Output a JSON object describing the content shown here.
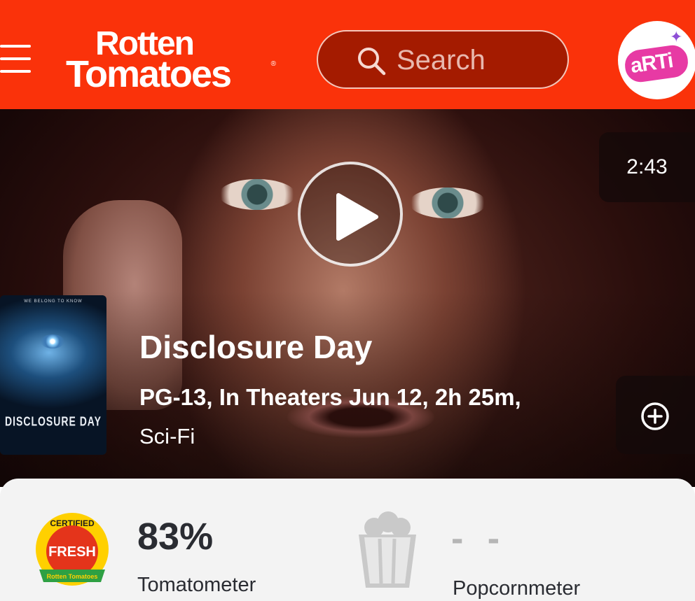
{
  "header": {
    "logo_line1": "Rotten",
    "logo_line2": "Tomatoes",
    "logo_reg": "®",
    "search_placeholder": "Search",
    "avatar_text": "aRTi",
    "brand_color": "#fa320a"
  },
  "hero": {
    "trailer_duration": "2:43",
    "poster": {
      "tagline": "WE BELONG TO KNOW",
      "title": "DISCLOSURE DAY"
    },
    "title": "Disclosure Day",
    "info": "PG-13, In Theaters Jun 12, 2h 25m,",
    "genre": "Sci-Fi"
  },
  "scores": {
    "tomatometer": {
      "badge_top": "CERTIFIED",
      "badge_main": "FRESH",
      "badge_bottom": "Rotten Tomatoes",
      "value": "83%",
      "label": "Tomatometer"
    },
    "popcornmeter": {
      "value": "- -",
      "label": "Popcornmeter"
    }
  },
  "icons": [
    "menu-icon",
    "search-icon",
    "play-icon",
    "add-circle-icon",
    "certified-fresh-icon",
    "popcorn-icon"
  ]
}
